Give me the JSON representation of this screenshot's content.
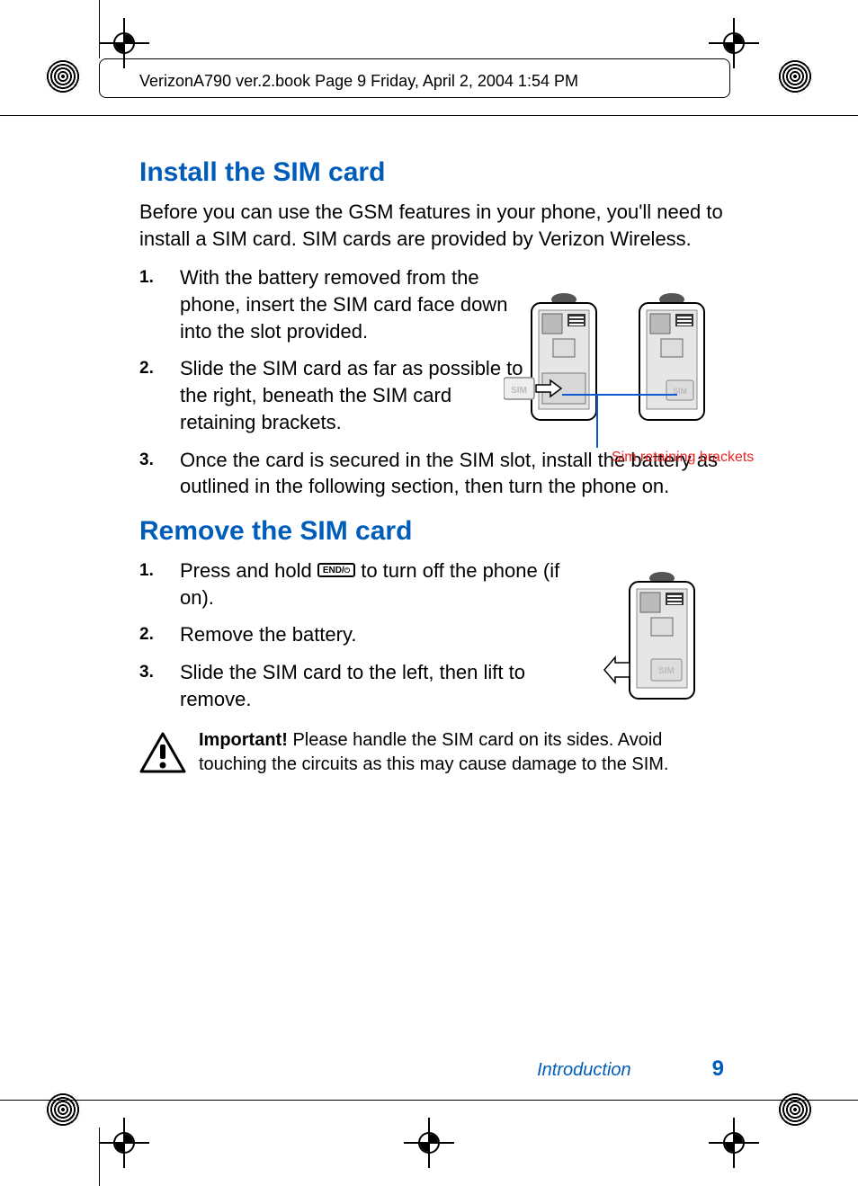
{
  "header": "VerizonA790 ver.2.book  Page 9  Friday, April 2, 2004  1:54 PM",
  "section1": {
    "title": "Install the SIM card",
    "intro": "Before you can use the GSM features in your phone, you'll need to install a SIM card. SIM cards are provided by Verizon Wireless.",
    "steps": [
      "With the battery removed from the phone, insert the SIM card face down into the slot provided.",
      "Slide the SIM card as far as possible to the right, beneath the SIM card retaining brackets.",
      "Once the card is secured in the SIM slot, install the battery as outlined in the following section, then turn the phone on."
    ],
    "annotation": "Sim retaining brackets"
  },
  "section2": {
    "title": "Remove the SIM card",
    "key_label": "END/",
    "step1_a": "Press and hold ",
    "step1_b": " to turn off the phone (if on).",
    "steps_rest": [
      "Remove the battery.",
      "Slide the SIM card to the left, then lift to remove."
    ]
  },
  "important": {
    "label": "Important!",
    "text": " Please handle the SIM card on its sides. Avoid touching the circuits as this may cause damage to the SIM."
  },
  "footer": {
    "section": "Introduction",
    "page": "9"
  }
}
